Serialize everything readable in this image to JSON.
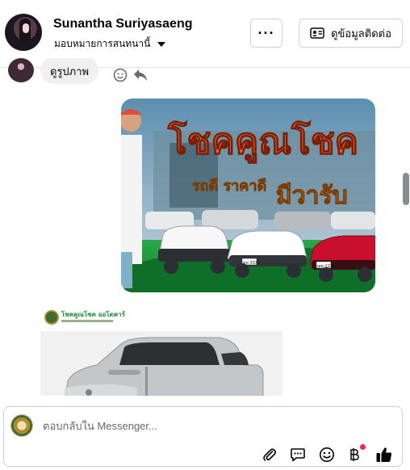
{
  "header": {
    "contact_name": "Sunantha Suriyasaeng",
    "assign_label": "มอบหมายการสนทนานี้",
    "more_label": "···",
    "view_contact_label": "ดูข้อมูลติดต่อ"
  },
  "messages": {
    "bubble_text": "ดูรูปภาพ",
    "image1": {
      "headline": "โชคคูณโชค",
      "subline": "รถดี ราคาดี",
      "subline2": "มีวารับ",
      "plate1": "ขข 3333",
      "plate2": "ฌฆ 2222"
    },
    "image2": {
      "brand_text": "โชคคูณโชค ออโตคาร์"
    }
  },
  "composer": {
    "placeholder": "ตอบกลับใน Messenger..."
  },
  "icons": {
    "attach": "paperclip-icon",
    "saved_reply": "chat-bubble-icon",
    "emoji": "smiley-icon",
    "payment": "baht-icon",
    "like": "thumbs-up-icon"
  },
  "colors": {
    "like_blue": "#050505",
    "notif_red": "#f02849",
    "headline_orange": "#ff6a1a",
    "banner_green": "#1f8a3b"
  }
}
